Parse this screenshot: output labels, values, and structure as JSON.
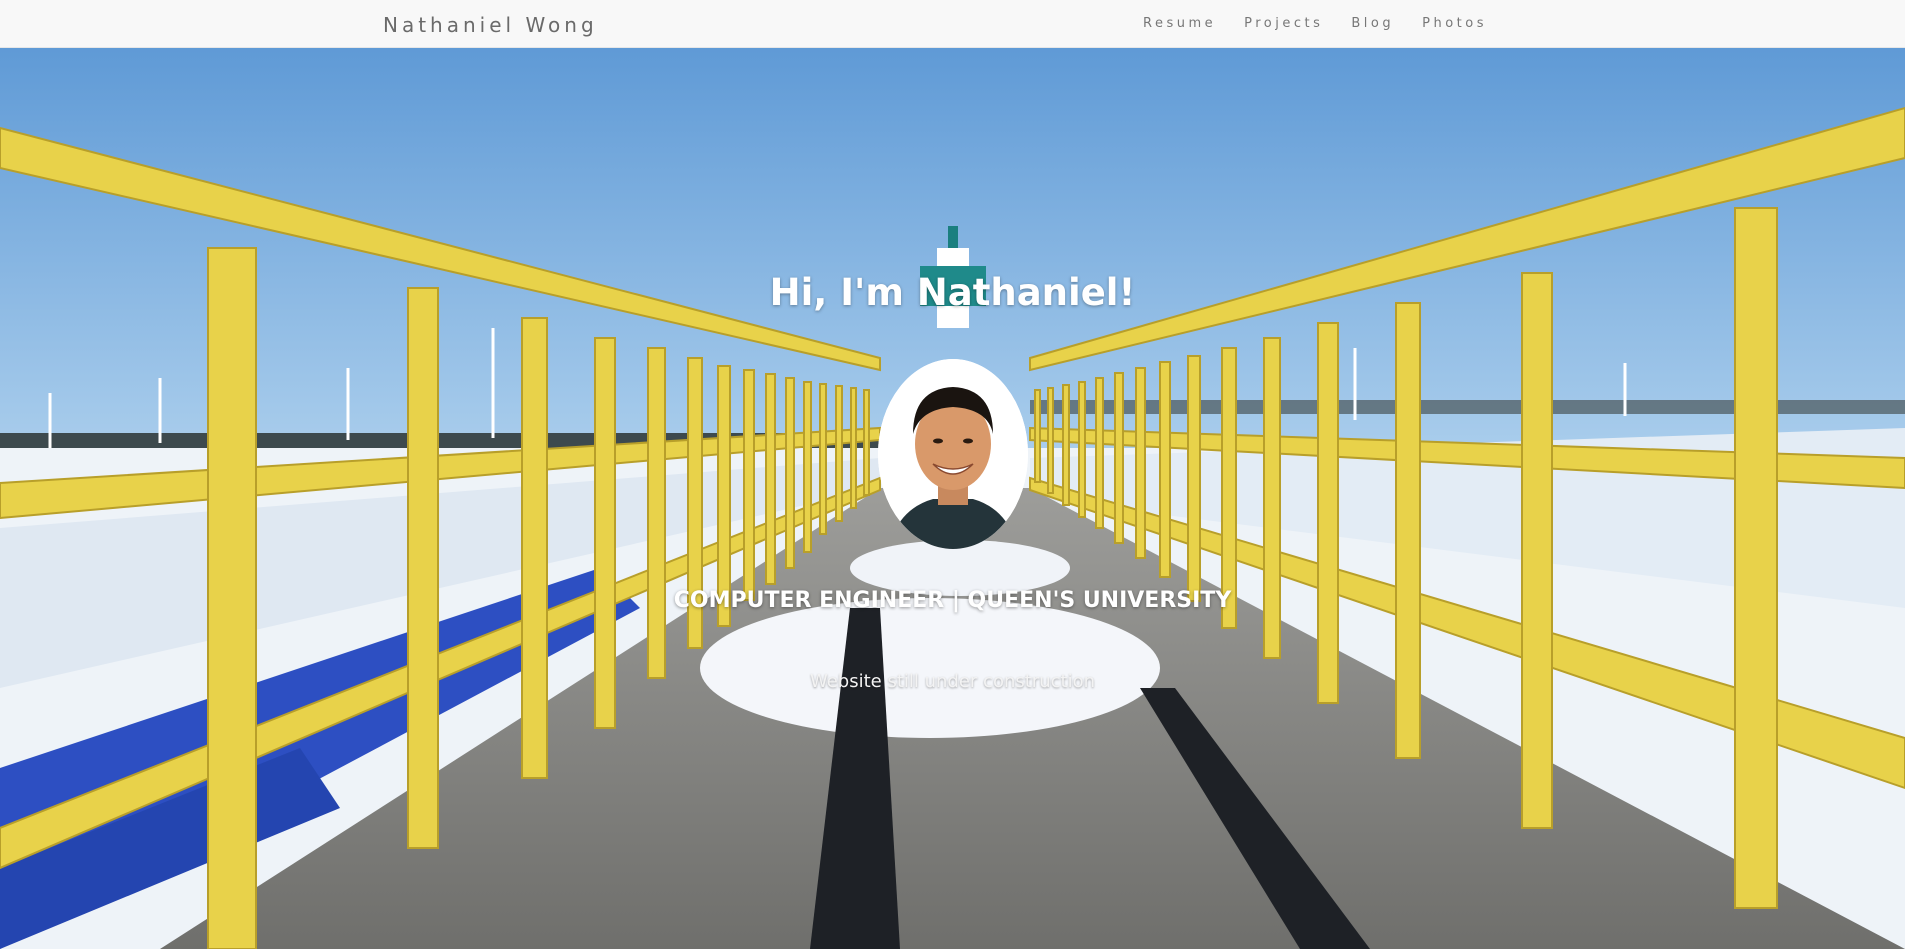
{
  "navbar": {
    "brand": "Nathaniel Wong",
    "links": [
      {
        "label": "Resume"
      },
      {
        "label": "Projects"
      },
      {
        "label": "Blog"
      },
      {
        "label": "Photos"
      }
    ]
  },
  "hero": {
    "title": "Hi, I'm Nathaniel!",
    "subtitle": "COMPUTER ENGINEER | QUEEN'S UNIVERSITY",
    "note": "Website still under construction",
    "background_image": "pier-with-yellow-railings-snow-wind-turbines",
    "avatar_image": "profile-photo"
  },
  "colors": {
    "sky": "#7fb4e0",
    "railing": "#e8d24a",
    "snow": "#eef3f8",
    "pier": "#8a8a88",
    "navbar_bg": "#f8f8f8",
    "nav_text": "#777777"
  }
}
